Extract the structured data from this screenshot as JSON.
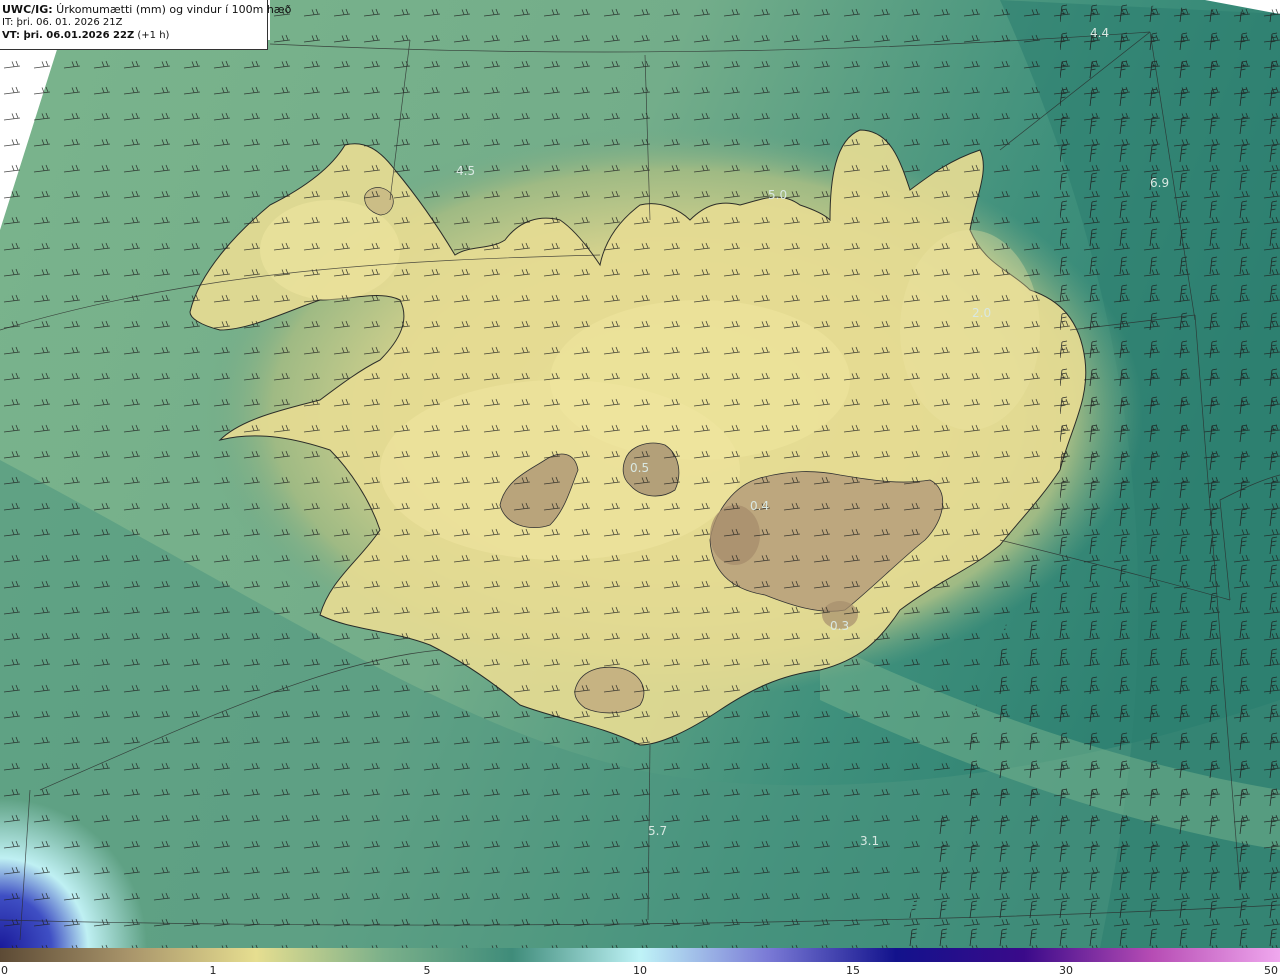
{
  "header": {
    "line1_bold": "UWC/IG:",
    "line1_text": " Úrkomumætti (mm) og vindur í 100m hæð",
    "line2": "IT: þri. 06. 01. 2026 21Z",
    "line3_bold": "VT: þri. 06.01.2026 22Z",
    "line3_text": " (+1 h)"
  },
  "map_labels": [
    {
      "id": "lbl-4-4",
      "text": "4.4"
    },
    {
      "id": "lbl-4-5",
      "text": "4.5"
    },
    {
      "id": "lbl-5-0",
      "text": "5.0"
    },
    {
      "id": "lbl-6-9",
      "text": "6.9"
    },
    {
      "id": "lbl-2-0",
      "text": "2.0"
    },
    {
      "id": "lbl-0-5",
      "text": "0.5"
    },
    {
      "id": "lbl-0-4",
      "text": "0.4"
    },
    {
      "id": "lbl-0-3",
      "text": "0.3"
    },
    {
      "id": "lbl-5-7",
      "text": "5.7"
    },
    {
      "id": "lbl-3-1",
      "text": "3.1"
    }
  ],
  "colorbar": {
    "ticks": [
      "0",
      "1",
      "5",
      "10",
      "15",
      "30",
      "50"
    ],
    "colors": [
      "#5c4a35",
      "#a8946a",
      "#e6de90",
      "#7bb08a",
      "#3f8c7a",
      "#bff3f7",
      "#7a7ad6",
      "#12128c",
      "#3a0a8a",
      "#b64cb4",
      "#f0a8ee"
    ]
  },
  "map_colors": {
    "sea_deep": "#3d8a78",
    "sea_light": "#6aa98a",
    "land_low": "#e4d98e",
    "land_mid": "#c9c48a",
    "glacier": "#b3a079",
    "cyan": "#c3f4f2",
    "blue": "#2a2aa6",
    "coast": "#222222"
  }
}
